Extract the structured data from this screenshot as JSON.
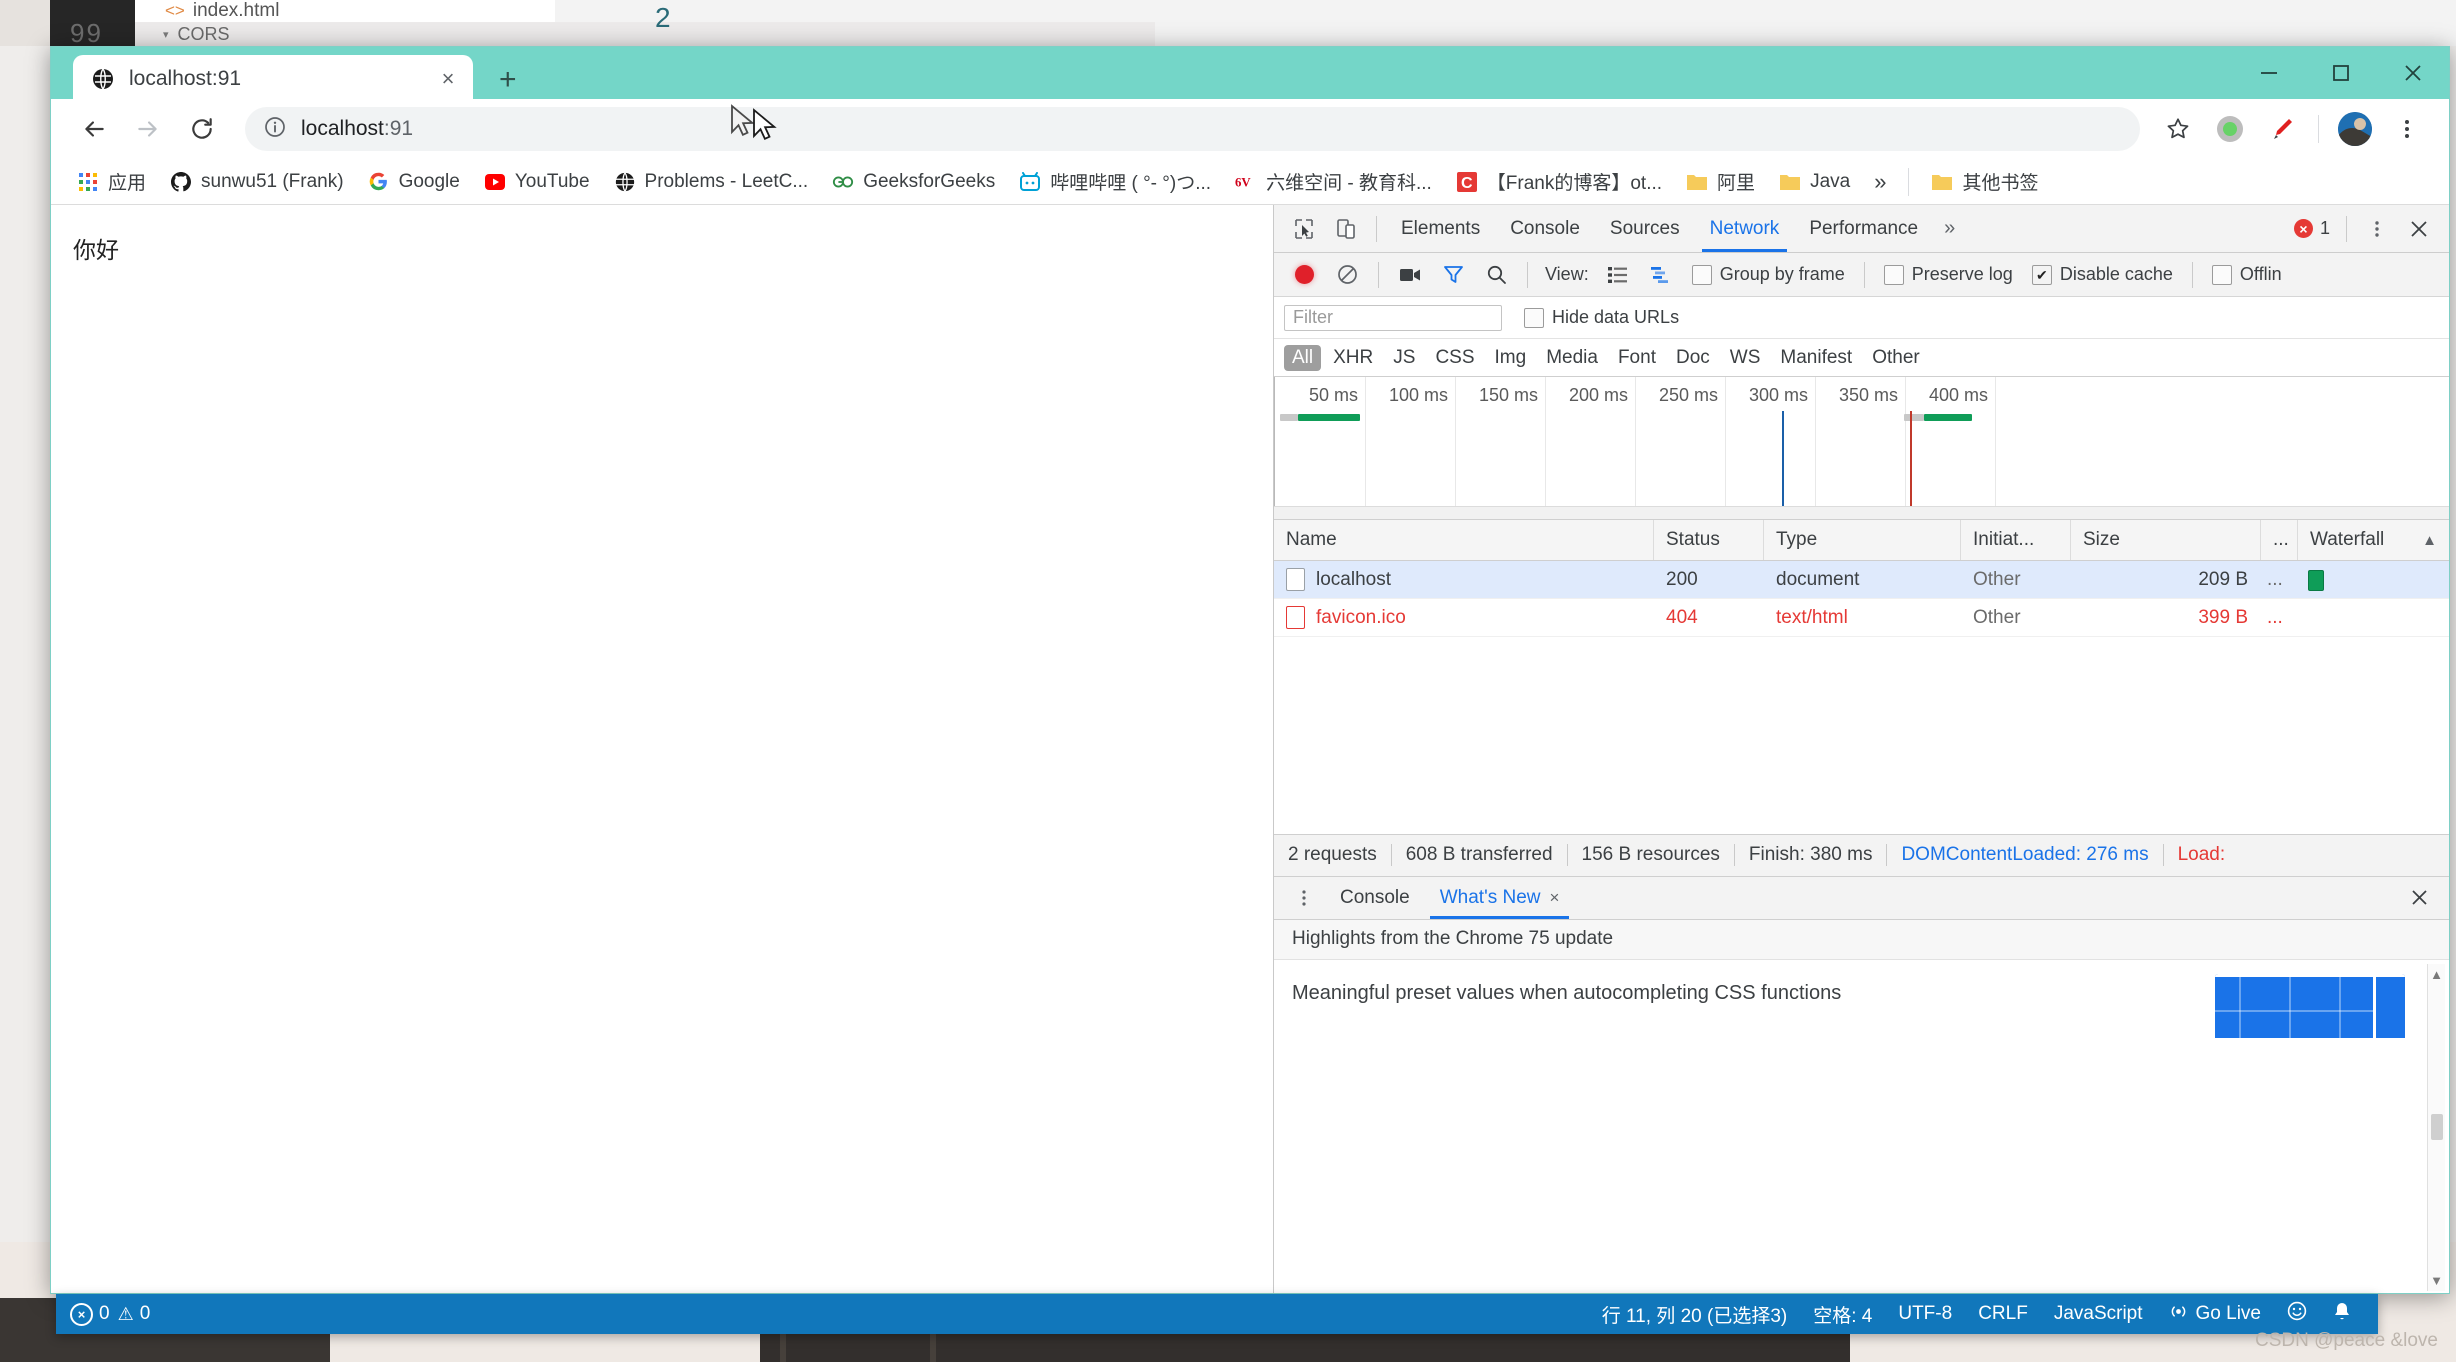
{
  "background_app": {
    "editor_tab": "index.html",
    "breadcrumb": "CORS",
    "minimap_number": "2",
    "gutter_numbers": "99"
  },
  "browser": {
    "tab": {
      "title": "localhost:91",
      "favicon": "globe-icon",
      "close": "×"
    },
    "new_tab_label": "+",
    "window_controls": {
      "minimize": "minimize-icon",
      "maximize": "maximize-icon",
      "close": "close-icon"
    },
    "omnibox": {
      "url_main": "localhost",
      "url_port": ":91",
      "info_icon": "info-circle-icon"
    },
    "toolbar_icons": [
      "star-icon",
      "extension-green-icon",
      "pen-red-icon",
      "profile-avatar",
      "chrome-menu-icon"
    ],
    "bookmarks": [
      {
        "label": "应用",
        "icon": "apps-grid-icon"
      },
      {
        "label": "sunwu51 (Frank)",
        "icon": "github-icon"
      },
      {
        "label": "Google",
        "icon": "google-g-icon"
      },
      {
        "label": "YouTube",
        "icon": "youtube-icon"
      },
      {
        "label": "Problems - LeetC...",
        "icon": "globe-icon"
      },
      {
        "label": "GeeksforGeeks",
        "icon": "gfg-icon"
      },
      {
        "label": "哔哩哔哩 ( °- °)つ...",
        "icon": "bilibili-icon"
      },
      {
        "label": "六维空间 - 教育科...",
        "icon": "sixwei-icon"
      },
      {
        "label": "【Frank的博客】ot...",
        "icon": "csdn-c-icon"
      },
      {
        "label": "阿里",
        "icon": "folder-icon"
      },
      {
        "label": "Java",
        "icon": "folder-icon"
      }
    ],
    "bookmarks_overflow": "»",
    "other_bookmarks": {
      "label": "其他书签",
      "icon": "folder-icon"
    }
  },
  "page": {
    "body_text": "你好"
  },
  "devtools": {
    "panel_tabs": [
      {
        "label": "Elements",
        "active": false
      },
      {
        "label": "Console",
        "active": false
      },
      {
        "label": "Sources",
        "active": false
      },
      {
        "label": "Network",
        "active": true
      },
      {
        "label": "Performance",
        "active": false
      }
    ],
    "panel_overflow": "»",
    "error_count": "1",
    "menu_icon": "kebab-menu-icon",
    "close_icon": "close-icon",
    "inspect_icon": "inspect-element-icon",
    "device_icon": "device-toolbar-icon",
    "toolbar": {
      "record_icon": "record-red-icon",
      "clear_icon": "clear-no-entry-icon",
      "screenshot_icon": "camera-icon",
      "filter_icon": "funnel-blue-icon",
      "search_icon": "search-icon",
      "view_label": "View:",
      "view_list_icon": "list-view-icon",
      "view_waterfall_icon": "waterfall-view-icon",
      "group_by_frame": {
        "label": "Group by frame",
        "checked": false
      },
      "preserve_log": {
        "label": "Preserve log",
        "checked": false
      },
      "disable_cache": {
        "label": "Disable cache",
        "checked": true
      },
      "offline": {
        "label": "Offlin",
        "checked": false
      }
    },
    "filter": {
      "placeholder": "Filter",
      "value": ""
    },
    "hide_data_urls": {
      "label": "Hide data URLs",
      "checked": false
    },
    "type_filters": [
      "All",
      "XHR",
      "JS",
      "CSS",
      "Img",
      "Media",
      "Font",
      "Doc",
      "WS",
      "Manifest",
      "Other"
    ],
    "type_filter_active": "All",
    "overview": {
      "tick_labels": [
        "50 ms",
        "100 ms",
        "150 ms",
        "200 ms",
        "250 ms",
        "300 ms",
        "350 ms",
        "400 ms"
      ],
      "dcl_marker_ms": 276,
      "load_marker_ms": 380,
      "dcl_color": "#1a5fa8",
      "load_color": "#c0392b",
      "bar_color": "#0f9d58"
    },
    "table": {
      "columns": [
        "Name",
        "Status",
        "Type",
        "Initiat...",
        "Size",
        "...",
        "Waterfall"
      ],
      "sort_indicator": "▲",
      "rows": [
        {
          "name": "localhost",
          "status": "200",
          "type": "document",
          "initiator": "Other",
          "size": "209 B",
          "overflow": "...",
          "error": false,
          "selected": true
        },
        {
          "name": "favicon.ico",
          "status": "404",
          "type": "text/html",
          "initiator": "Other",
          "size": "399 B",
          "overflow": "...",
          "error": true,
          "selected": false
        }
      ]
    },
    "summary": {
      "requests": "2 requests",
      "transferred": "608 B transferred",
      "resources": "156 B resources",
      "finish": "Finish: 380 ms",
      "dom_content_loaded": "DOMContentLoaded: 276 ms",
      "load": "Load:"
    },
    "drawer": {
      "menu_icon": "kebab-menu-icon",
      "tabs": [
        {
          "label": "Console",
          "active": false,
          "closable": false
        },
        {
          "label": "What's New",
          "active": true,
          "closable": true,
          "close": "×"
        }
      ],
      "close_icon": "close-icon",
      "subtitle": "Highlights from the Chrome 75 update",
      "items": [
        "Meaningful preset values when autocompleting CSS functions"
      ]
    }
  },
  "vscode_status": {
    "errors": {
      "icon": "error-circle-icon",
      "count": "0"
    },
    "warnings": {
      "icon": "warning-triangle-icon",
      "count": "0"
    },
    "cursor_position": "行 11, 列 20 (已选择3)",
    "indentation": "空格: 4",
    "encoding": "UTF-8",
    "line_ending": "CRLF",
    "language": "JavaScript",
    "go_live": {
      "label": "Go Live",
      "icon": "broadcast-icon"
    },
    "feedback_icon": "smiley-icon",
    "bell_icon": "bell-icon"
  },
  "watermark": "CSDN @peace &love",
  "colors": {
    "tabstrip": "#74d6c8",
    "accent_blue": "#1a73e8",
    "status_blue": "#1177bb",
    "error_red": "#e53935",
    "success_green": "#0f9d58"
  }
}
